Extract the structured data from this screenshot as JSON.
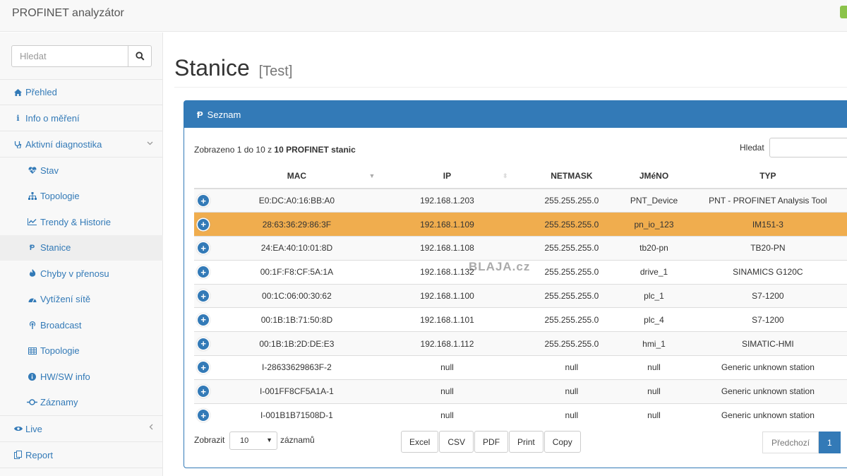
{
  "app": {
    "title": "PROFINET analyzátor"
  },
  "sidebar": {
    "search_placeholder": "Hledat",
    "items": [
      {
        "label": "Přehled"
      },
      {
        "label": "Info o měření"
      },
      {
        "label": "Aktivní diagnostika"
      },
      {
        "label": "Live"
      },
      {
        "label": "Report"
      }
    ],
    "subitems": [
      {
        "label": "Stav"
      },
      {
        "label": "Topologie"
      },
      {
        "label": "Trendy & Historie"
      },
      {
        "label": "Stanice"
      },
      {
        "label": "Chyby v přenosu"
      },
      {
        "label": "Vytížení sítě"
      },
      {
        "label": "Broadcast"
      },
      {
        "label": "Topologie"
      },
      {
        "label": "HW/SW info"
      },
      {
        "label": "Záznamy"
      }
    ]
  },
  "page": {
    "title": "Stanice",
    "subtitle": "[Test]"
  },
  "panel": {
    "heading": "Seznam",
    "info_prefix": "Zobrazeno 1 do 10 z ",
    "info_bold": "10 PROFINET stanic",
    "filter_label": "Hledat",
    "columns": [
      "MAC",
      "IP",
      "NETMASK",
      "JMéNO",
      "TYP"
    ],
    "rows": [
      {
        "mac": "E0:DC:A0:16:BB:A0",
        "ip": "192.168.1.203",
        "netmask": "255.255.255.0",
        "name": "PNT_Device",
        "type": "PNT - PROFINET Analysis Tool"
      },
      {
        "mac": "28:63:36:29:86:3F",
        "ip": "192.168.1.109",
        "netmask": "255.255.255.0",
        "name": "pn_io_123",
        "type": "IM151-3"
      },
      {
        "mac": "24:EA:40:10:01:8D",
        "ip": "192.168.1.108",
        "netmask": "255.255.255.0",
        "name": "tb20-pn",
        "type": "TB20-PN"
      },
      {
        "mac": "00:1F:F8:CF:5A:1A",
        "ip": "192.168.1.132",
        "netmask": "255.255.255.0",
        "name": "drive_1",
        "type": "SINAMICS G120C"
      },
      {
        "mac": "00:1C:06:00:30:62",
        "ip": "192.168.1.100",
        "netmask": "255.255.255.0",
        "name": "plc_1",
        "type": "S7-1200"
      },
      {
        "mac": "00:1B:1B:71:50:8D",
        "ip": "192.168.1.101",
        "netmask": "255.255.255.0",
        "name": "plc_4",
        "type": "S7-1200"
      },
      {
        "mac": "00:1B:1B:2D:DE:E3",
        "ip": "192.168.1.112",
        "netmask": "255.255.255.0",
        "name": "hmi_1",
        "type": "SIMATIC-HMI"
      },
      {
        "mac": "I-28633629863F-2",
        "ip": "null",
        "netmask": "null",
        "name": "null",
        "type": "Generic unknown station"
      },
      {
        "mac": "I-001FF8CF5A1A-1",
        "ip": "null",
        "netmask": "null",
        "name": "null",
        "type": "Generic unknown station"
      },
      {
        "mac": "I-001B1B71508D-1",
        "ip": "null",
        "netmask": "null",
        "name": "null",
        "type": "Generic unknown station"
      }
    ],
    "selected_row": 1,
    "length_label": "Zobrazit",
    "length_value": "10",
    "length_suffix": "záznamů",
    "export_buttons": [
      "Excel",
      "CSV",
      "PDF",
      "Print",
      "Copy"
    ],
    "pager": {
      "previous": "Předchozí",
      "current": "1"
    }
  },
  "watermark": "BLAJA.cz",
  "colors": {
    "primary": "#337ab7",
    "selected_row": "#f0ad4e"
  }
}
